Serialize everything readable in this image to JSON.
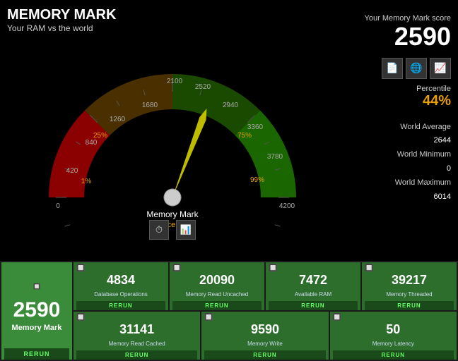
{
  "header": {
    "title": "MEMORY MARK",
    "subtitle": "Your RAM vs the world"
  },
  "score_panel": {
    "score_label": "Your Memory Mark score",
    "score_value": "2590",
    "percentile_label": "Percentile",
    "percentile_value": "44%",
    "world_average_label": "World Average",
    "world_average_value": "2644",
    "world_minimum_label": "World Minimum",
    "world_minimum_value": "0",
    "world_maximum_label": "World Maximum",
    "world_maximum_value": "6014"
  },
  "gauge": {
    "min": "0",
    "max": "4200",
    "labels": [
      "0",
      "420",
      "840",
      "1260",
      "1680",
      "2100",
      "2520",
      "2940",
      "3360",
      "3780",
      "4200"
    ],
    "percentile_1": "1%",
    "percentile_25": "25%",
    "percentile_75": "75%",
    "percentile_99": "99%",
    "label_main": "Memory Mark",
    "label_sub": "Percentile"
  },
  "main_tile": {
    "value": "2590",
    "label": "Memory Mark",
    "rerun": "RERUN"
  },
  "tiles": [
    {
      "value": "4834",
      "label": "Database Operations",
      "rerun": "RERUN"
    },
    {
      "value": "20090",
      "label": "Memory Read\nUncached",
      "rerun": "RERUN"
    },
    {
      "value": "7472",
      "label": "Available RAM",
      "rerun": "RERUN"
    },
    {
      "value": "39217",
      "label": "Memory Threaded",
      "rerun": "RERUN"
    },
    {
      "value": "31141",
      "label": "Memory Read Cached",
      "rerun": "RERUN"
    },
    {
      "value": "9590",
      "label": "Memory Write",
      "rerun": "RERUN"
    },
    {
      "value": "50",
      "label": "Memory Latency",
      "rerun": "RERUN"
    }
  ]
}
